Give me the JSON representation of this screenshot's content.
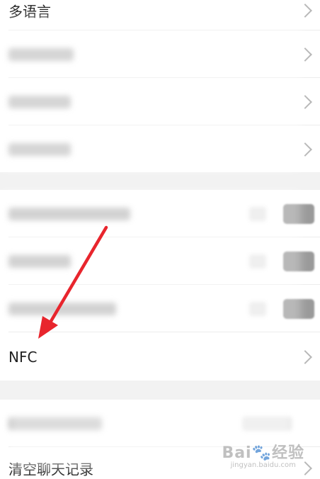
{
  "settings": {
    "multilang_label": "多语言",
    "nfc_label": "NFC",
    "clear_chat_label": "清空聊天记录"
  },
  "watermark": {
    "brand": "Bai🐾经验",
    "url": "jingyan.baidu.com"
  },
  "colors": {
    "annotation_arrow": "#e8252d",
    "chevron": "#b8b8b8",
    "section_gap": "#f2f2f2"
  },
  "icons": {
    "chevron": "chevron-right-icon",
    "arrow": "annotation-arrow"
  }
}
